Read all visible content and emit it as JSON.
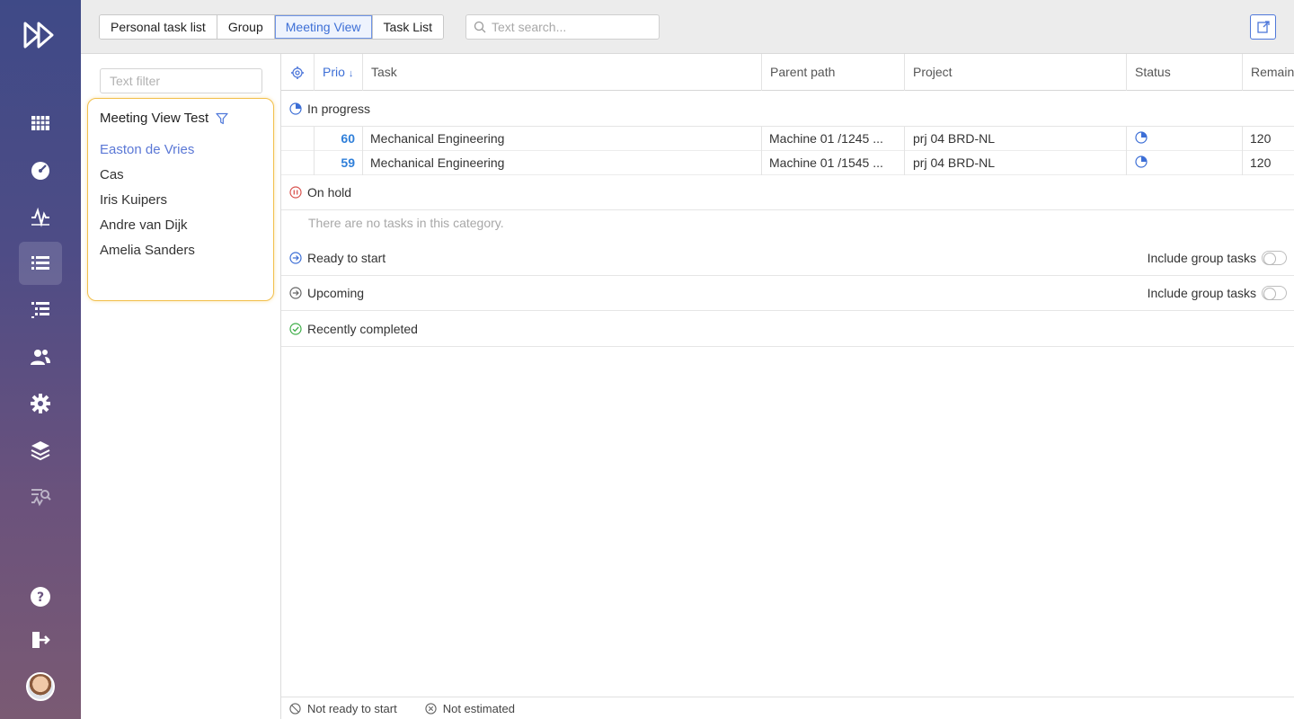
{
  "topbar": {
    "tabs": [
      {
        "label": "Personal task list"
      },
      {
        "label": "Group"
      },
      {
        "label": "Meeting View",
        "active": true
      },
      {
        "label": "Task List"
      }
    ],
    "search_placeholder": "Text search..."
  },
  "filter": {
    "placeholder": "Text filter",
    "group_title": "Meeting View Test",
    "members": [
      {
        "name": "Easton de Vries",
        "selected": true
      },
      {
        "name": "Cas"
      },
      {
        "name": "Iris Kuipers"
      },
      {
        "name": "Andre van Dijk"
      },
      {
        "name": "Amelia Sanders"
      }
    ]
  },
  "table": {
    "columns": {
      "prio": "Prio",
      "task": "Task",
      "parent_path": "Parent path",
      "project": "Project",
      "status": "Status",
      "remaining": "Remain"
    },
    "sections": {
      "in_progress": "In progress",
      "on_hold": "On hold",
      "on_hold_empty": "There are no tasks in this category.",
      "ready_to_start": "Ready to start",
      "upcoming": "Upcoming",
      "recently_completed": "Recently completed"
    },
    "include_group_tasks": "Include group tasks",
    "rows": [
      {
        "prio": "60",
        "task": "Mechanical Engineering",
        "parent_path": "Machine 01 /1245 ...",
        "project": "prj 04 BRD-NL",
        "remaining": "120"
      },
      {
        "prio": "59",
        "task": "Mechanical Engineering",
        "parent_path": "Machine 01 /1545 ...",
        "project": "prj 04 BRD-NL",
        "remaining": "120"
      }
    ]
  },
  "footer": {
    "not_ready": "Not ready to start",
    "not_estimated": "Not estimated"
  },
  "colors": {
    "accent": "#3d6fd6",
    "prio": "#2f7fd9",
    "card_border": "#f2c04d",
    "on_hold": "#d9534f",
    "completed": "#3fae49"
  },
  "icons": [
    "logo-icon",
    "calendar-grid-icon",
    "dashboard-gauge-icon",
    "activity-icon",
    "list-icon",
    "tree-list-icon",
    "users-icon",
    "gear-icon",
    "layers-icon",
    "analytics-icon",
    "help-icon",
    "logout-icon",
    "search-icon",
    "export-icon",
    "filter-icon",
    "settings-icon",
    "sort-down-icon",
    "pie-progress-icon",
    "pause-icon",
    "arrow-right-icon",
    "check-icon",
    "not-ready-icon",
    "not-estimated-icon"
  ]
}
